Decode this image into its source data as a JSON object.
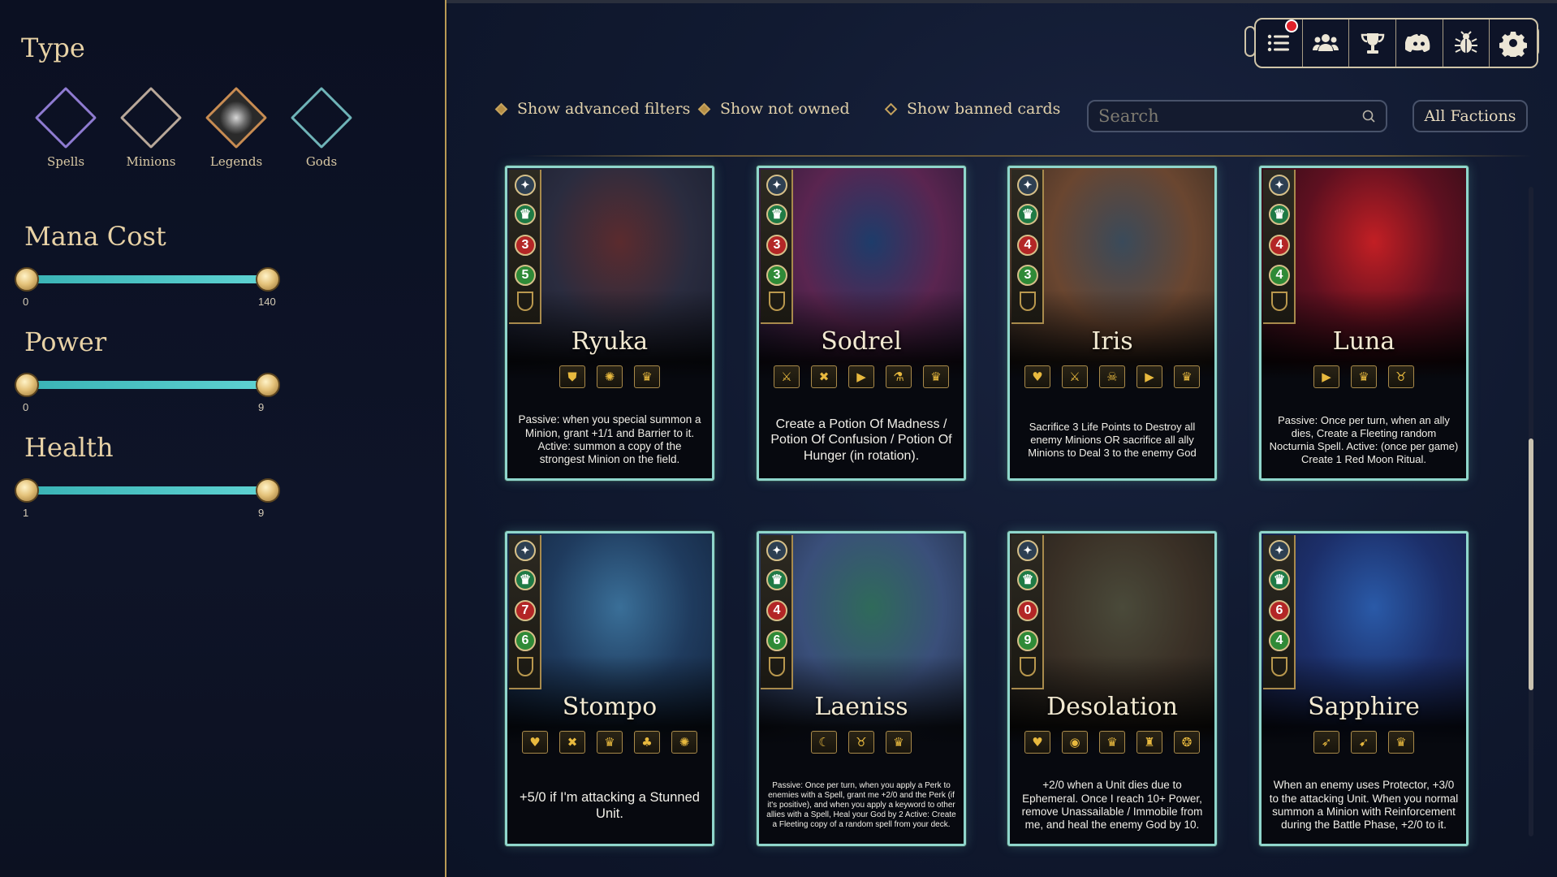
{
  "sidebar": {
    "type_title": "Type",
    "types": [
      {
        "label": "Spells",
        "color": "#8f7bd1"
      },
      {
        "label": "Minions",
        "color": "#b9a899"
      },
      {
        "label": "Legends",
        "color": "#c88c52"
      },
      {
        "label": "Gods",
        "color": "#6fb4b8"
      }
    ],
    "sliders": [
      {
        "title": "Mana Cost",
        "min": "0",
        "max": "140"
      },
      {
        "title": "Power",
        "min": "0",
        "max": "9"
      },
      {
        "title": "Health",
        "min": "1",
        "max": "9"
      }
    ]
  },
  "topbar": {
    "icons": [
      "menu-list-icon",
      "friends-icon",
      "trophy-icon",
      "discord-icon",
      "bug-icon",
      "settings-gear-icon"
    ]
  },
  "filters": {
    "advanced": "Show advanced filters",
    "not_owned": "Show not owned",
    "banned": "Show banned cards"
  },
  "search": {
    "placeholder": "Search"
  },
  "factions": {
    "selected": "All Factions"
  },
  "cards": [
    {
      "name": "Ryuka",
      "power": "3",
      "health": "5",
      "art": [
        "#5b2b2e",
        "#2a2c3f",
        "#151a2a"
      ],
      "keywords": [
        "⛊",
        "✺",
        "♛"
      ],
      "text": "Passive: when you special summon a Minion, grant +1/1 and Barrier to it. Active: summon a copy of the strongest Minion on the field."
    },
    {
      "name": "Sodrel",
      "power": "3",
      "health": "3",
      "art": [
        "#1e3c6a",
        "#5a2550",
        "#1b1830"
      ],
      "keywords": [
        "⚔",
        "✖",
        "▶",
        "⚗",
        "♛"
      ],
      "text": "Create a Potion Of Madness / Potion Of Confusion / Potion Of Hunger (in rotation)."
    },
    {
      "name": "Iris",
      "power": "4",
      "health": "3",
      "art": [
        "#3a4a5a",
        "#6a4630",
        "#2a2420"
      ],
      "keywords": [
        "♥",
        "⚔",
        "☠",
        "▶",
        "♛"
      ],
      "text": "Sacrifice 3 Life Points to Destroy all enemy Minions OR sacrifice all ally Minions to Deal 3 to the enemy God"
    },
    {
      "name": "Luna",
      "power": "4",
      "health": "4",
      "art": [
        "#c21f24",
        "#5e1020",
        "#1c0c14"
      ],
      "keywords": [
        "▶",
        "♛",
        "♉"
      ],
      "text": "Passive: Once per turn, when an ally dies, Create a Fleeting random Nocturnia Spell. Active: (once per game) Create 1 Red Moon Ritual."
    },
    {
      "name": "Stompo",
      "power": "7",
      "health": "6",
      "art": [
        "#3a6f98",
        "#1f3b5e",
        "#0f1d33"
      ],
      "keywords": [
        "♥",
        "✖",
        "♛",
        "♣",
        "✺"
      ],
      "text": "+5/0 if I'm attacking a Stunned Unit."
    },
    {
      "name": "Laeniss",
      "power": "4",
      "health": "6",
      "art": [
        "#2f6a5a",
        "#3a4f7a",
        "#1a2236"
      ],
      "keywords": [
        "☾",
        "♉",
        "♛"
      ],
      "text": "Passive: Once per turn, when you apply a Perk to enemies with a Spell, grant me +2/0 and the Perk (if it's positive), and when you apply a keyword to other allies with a Spell, Heal your God by 2 Active: Create a Fleeting copy of a random spell from your deck."
    },
    {
      "name": "Desolation",
      "power": "0",
      "health": "9",
      "art": [
        "#4a4a3a",
        "#3a3026",
        "#1a1a18"
      ],
      "keywords": [
        "♥",
        "◉",
        "♛",
        "♜",
        "❂"
      ],
      "text": "+2/0 when a Unit dies due to Ephemeral. Once I reach 10+ Power, remove Unassailable / Immobile from me, and heal the enemy God by 10."
    },
    {
      "name": "Sapphire",
      "power": "6",
      "health": "4",
      "art": [
        "#2a5aa8",
        "#1c2f6a",
        "#141a38"
      ],
      "keywords": [
        "➶",
        "➹",
        "♛"
      ],
      "text": "When an enemy uses Protector, +3/0 to the attacking Unit. When you normal summon a Minion with Reinforcement during the Battle Phase, +2/0 to it."
    }
  ]
}
